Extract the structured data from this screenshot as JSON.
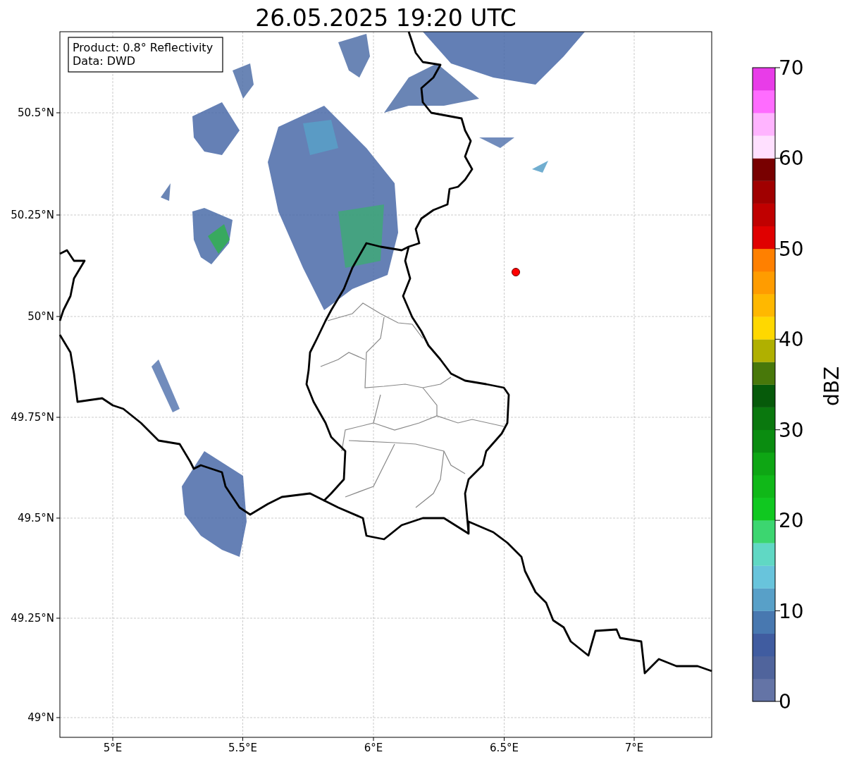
{
  "title": "26.05.2025 19:20 UTC",
  "info_box": {
    "lines": [
      "Product: 0.8° Reflectivity",
      "Data: DWD"
    ]
  },
  "map": {
    "x_ticks": [
      "5°E",
      "5.5°E",
      "6°E",
      "6.5°E",
      "7°E"
    ],
    "y_ticks": [
      "50.5°N",
      "50.25°N",
      "50°N",
      "49.75°N",
      "49.5°N",
      "49.25°N",
      "49°N"
    ]
  },
  "colorbar": {
    "label": "dBZ",
    "ticks": [
      "70",
      "60",
      "50",
      "40",
      "30",
      "20",
      "10",
      "0"
    ],
    "bands": [
      {
        "color": "#6474a6"
      },
      {
        "color": "#50649c"
      },
      {
        "color": "#405ca0"
      },
      {
        "color": "#4878b0"
      },
      {
        "color": "#58a0c8"
      },
      {
        "color": "#68c4dc"
      },
      {
        "color": "#60d8c4"
      },
      {
        "color": "#3cd670"
      },
      {
        "color": "#10c820"
      },
      {
        "color": "#10b818"
      },
      {
        "color": "#0ea614"
      },
      {
        "color": "#0a8c10"
      },
      {
        "color": "#0a780e"
      },
      {
        "color": "#065a0a"
      },
      {
        "color": "#48780a"
      },
      {
        "color": "#b0b000"
      },
      {
        "color": "#ffd800"
      },
      {
        "color": "#ffb800"
      },
      {
        "color": "#ff9c00"
      },
      {
        "color": "#ff8000"
      },
      {
        "color": "#e00000"
      },
      {
        "color": "#c00000"
      },
      {
        "color": "#a00000"
      },
      {
        "color": "#780000"
      },
      {
        "color": "#ffe0ff"
      },
      {
        "color": "#ffb4ff"
      },
      {
        "color": "#ff6cff"
      },
      {
        "color": "#e83ce8"
      }
    ]
  }
}
